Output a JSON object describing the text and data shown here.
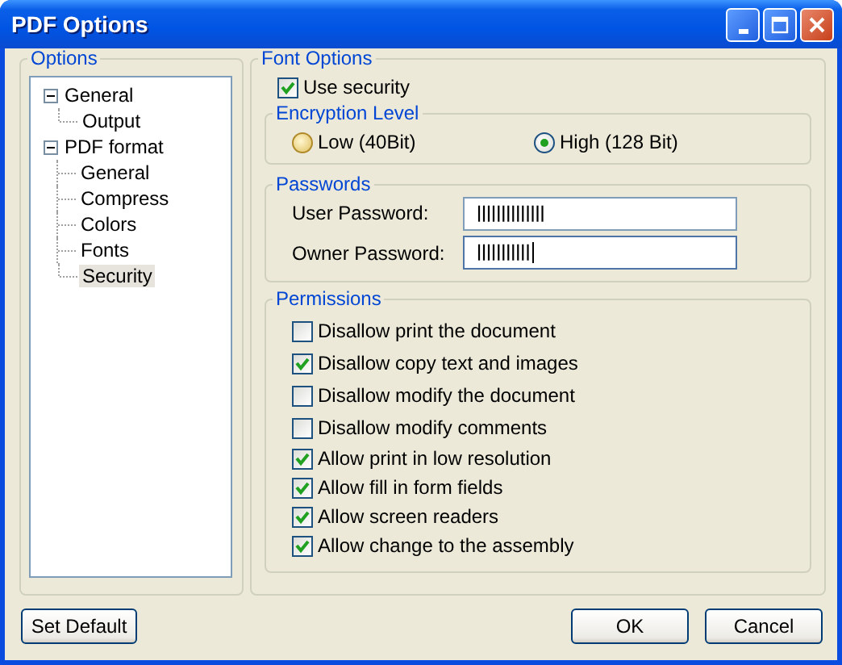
{
  "window": {
    "title": "PDF Options"
  },
  "options": {
    "title": "Options",
    "tree": [
      {
        "label": "General",
        "expanded": true,
        "selected": false,
        "children": [
          {
            "label": "Output",
            "selected": false
          }
        ]
      },
      {
        "label": "PDF format",
        "expanded": true,
        "selected": false,
        "children": [
          {
            "label": "General",
            "selected": false
          },
          {
            "label": "Compress",
            "selected": false
          },
          {
            "label": "Colors",
            "selected": false
          },
          {
            "label": "Fonts",
            "selected": false
          },
          {
            "label": "Security",
            "selected": true
          }
        ]
      }
    ]
  },
  "font_options": {
    "title": "Font Options",
    "use_security": {
      "label": "Use security",
      "checked": true
    },
    "encryption": {
      "title": "Encryption Level",
      "options": [
        {
          "label": "Low (40Bit)",
          "selected": false
        },
        {
          "label": "High (128 Bit)",
          "selected": true
        }
      ]
    },
    "passwords": {
      "title": "Passwords",
      "fields": [
        {
          "label": "User Password:",
          "value": "||||||||||||||",
          "focused": false
        },
        {
          "label": "Owner Password:",
          "value": "|||||||||||",
          "focused": true
        }
      ]
    },
    "permissions": {
      "title": "Permissions",
      "items": [
        {
          "label": "Disallow print the document",
          "checked": false
        },
        {
          "label": "Disallow copy text and images",
          "checked": true
        },
        {
          "label": "Disallow modify the document",
          "checked": false
        },
        {
          "label": "Disallow modify comments",
          "checked": false
        },
        {
          "label": "Allow print in low resolution",
          "checked": true
        },
        {
          "label": "Allow fill in form fields",
          "checked": true
        },
        {
          "label": "Allow screen readers",
          "checked": true
        },
        {
          "label": "Allow change to the assembly",
          "checked": true
        }
      ]
    }
  },
  "buttons": {
    "set_default": "Set Default",
    "ok": "OK",
    "cancel": "Cancel"
  }
}
